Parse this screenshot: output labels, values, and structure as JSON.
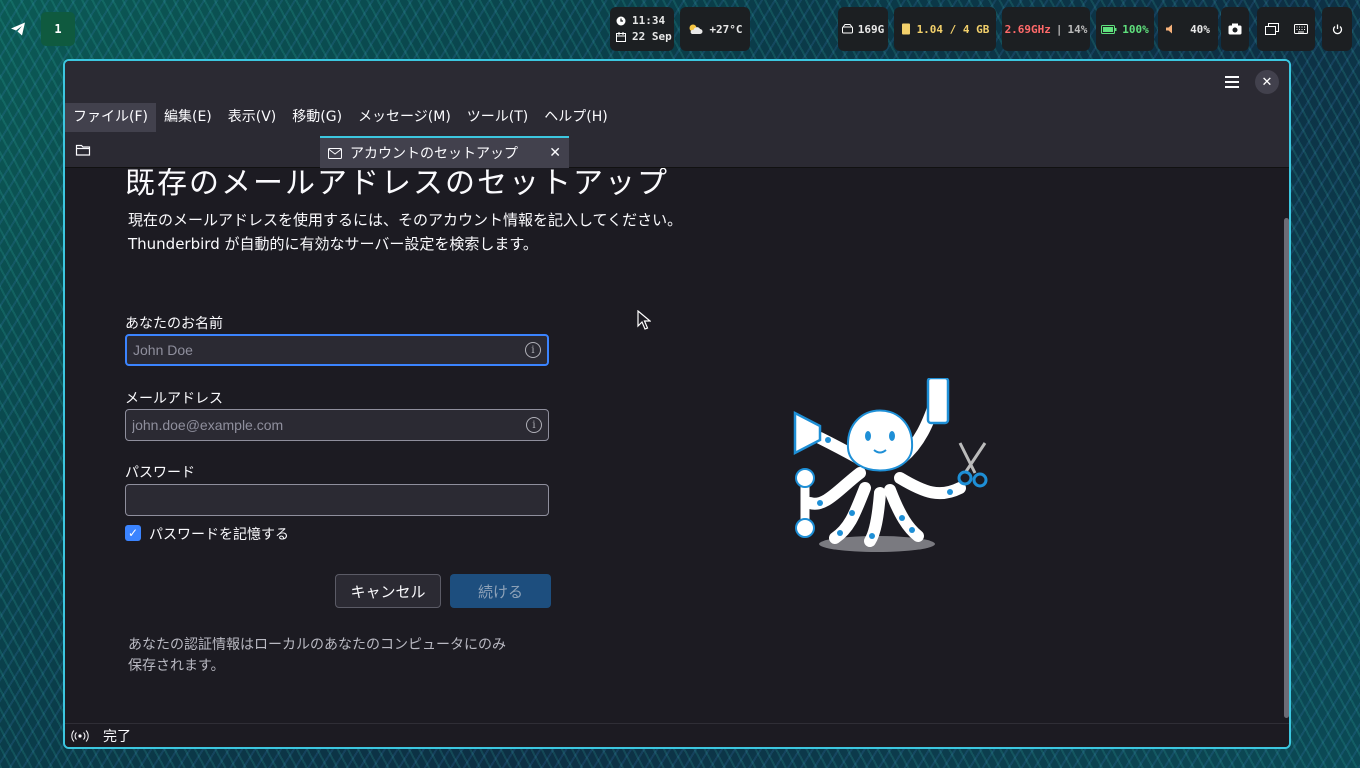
{
  "taskbar": {
    "workspace": "1",
    "time": "11:34",
    "date": "22 Sep",
    "weather": "+27°C",
    "disk": "169G",
    "memory": "1.04 / 4 GB",
    "cpu_freq": "2.69GHz",
    "cpu_sep": "|",
    "cpu_usage": "14%",
    "battery": "100%",
    "volume": "40%"
  },
  "window": {
    "menus": [
      "ファイル(F)",
      "編集(E)",
      "表示(V)",
      "移動(G)",
      "メッセージ(M)",
      "ツール(T)",
      "ヘルプ(H)"
    ],
    "tab_title": "アカウントのセットアップ"
  },
  "setup": {
    "heading": "既存のメールアドレスのセットアップ",
    "desc_line1": "現在のメールアドレスを使用するには、そのアカウント情報を記入してください。",
    "desc_line2": "Thunderbird が自動的に有効なサーバー設定を検索します。",
    "name_label": "あなたのお名前",
    "name_placeholder": "John Doe",
    "email_label": "メールアドレス",
    "email_placeholder": "john.doe@example.com",
    "password_label": "パスワード",
    "remember_label": "パスワードを記憶する",
    "cancel_label": "キャンセル",
    "continue_label": "続ける",
    "note_line1": "あなたの認証情報はローカルのあなたのコンピュータにのみ",
    "note_line2": "保存されます。"
  },
  "status": {
    "text": "完了"
  },
  "colors": {
    "accent": "#3cc7e0",
    "focus": "#3b84ff",
    "continue_bg": "#1d4e7e"
  }
}
